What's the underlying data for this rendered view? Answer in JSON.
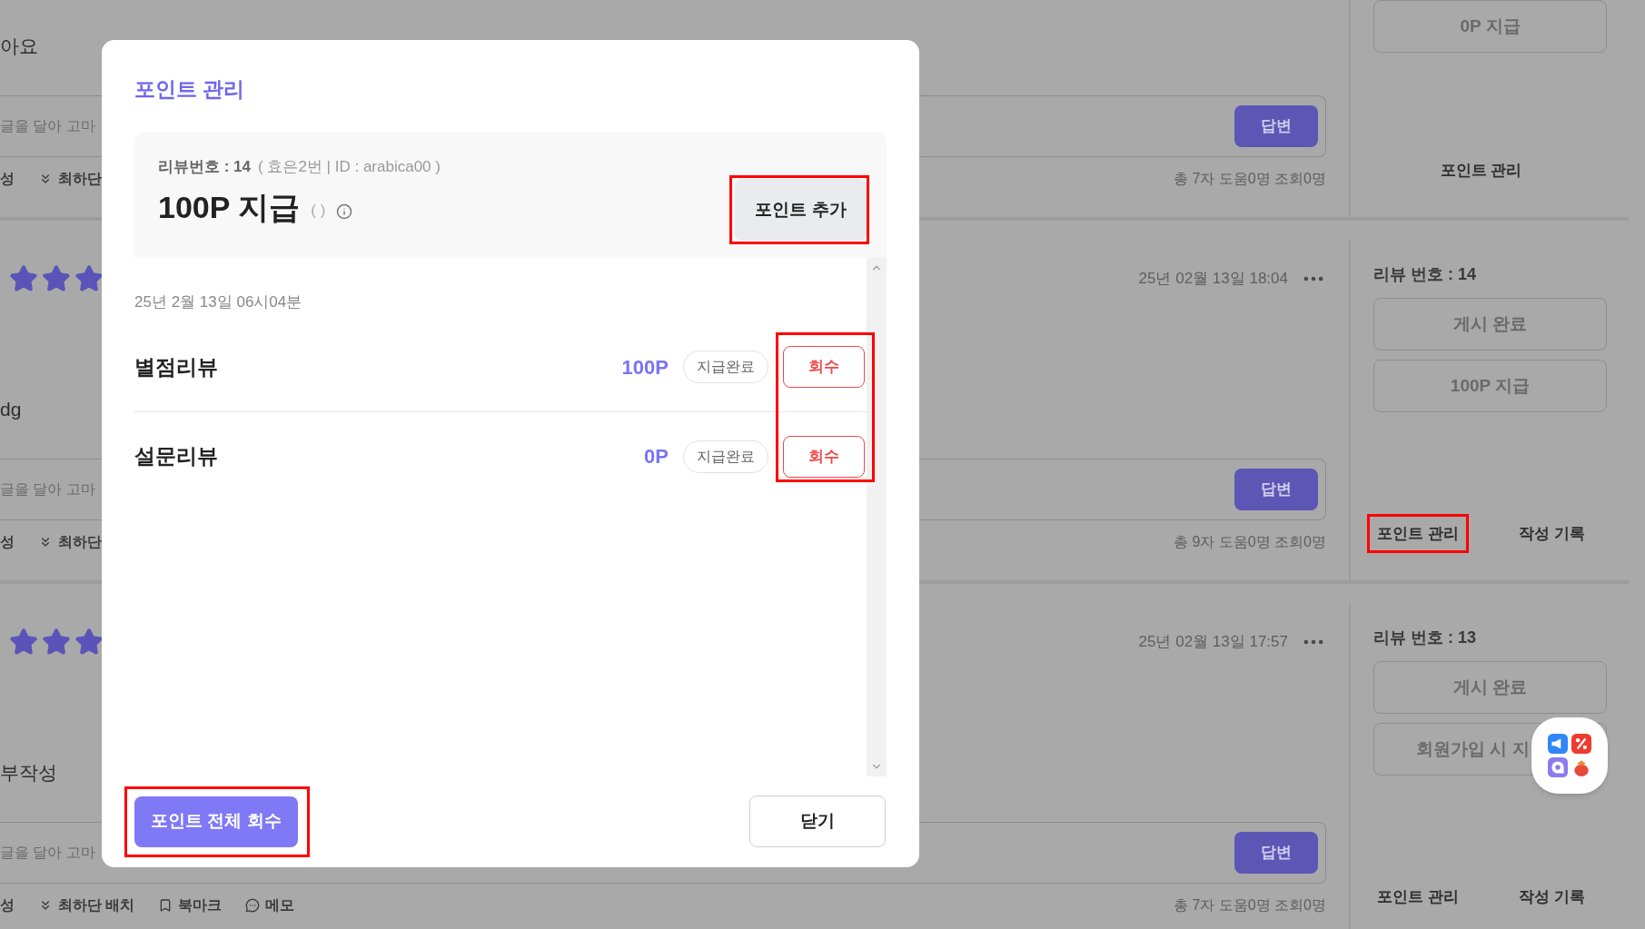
{
  "reviews": [
    {
      "body": "아요",
      "reply_placeholder": "글을 달아 고마",
      "reply_button": "답변",
      "toolbar": [
        {
          "label": "성",
          "kind": "plain"
        },
        {
          "label": "최하단",
          "kind": "bottom"
        }
      ],
      "stats": "총 7자 도움0명 조회0명",
      "side": {
        "buttons": [
          "0P 지급"
        ],
        "links": [
          {
            "label": "포인트 관리",
            "highlighted": false
          }
        ]
      }
    },
    {
      "stars": 3,
      "date": "25년 02월 13일 18:04",
      "body": "dg",
      "reply_placeholder": "글을 달아 고마",
      "reply_button": "답변",
      "toolbar": [
        {
          "label": "성",
          "kind": "plain"
        },
        {
          "label": "최하단",
          "kind": "bottom"
        }
      ],
      "stats": "총 9자 도움0명 조회0명",
      "side": {
        "label": "리뷰 번호 : 14",
        "buttons": [
          "게시 완료",
          "100P 지급"
        ],
        "links": [
          {
            "label": "포인트 관리",
            "highlighted": true
          },
          {
            "label": "작성 기록",
            "highlighted": false
          }
        ]
      }
    },
    {
      "stars": 3,
      "date": "25년 02월 13일 17:57",
      "body": "부작성",
      "reply_placeholder": "글을 달아 고마",
      "reply_button": "답변",
      "toolbar": [
        {
          "label": "성",
          "kind": "plain"
        },
        {
          "label": "최하단 배치",
          "kind": "bottom"
        },
        {
          "label": "북마크",
          "kind": "bookmark"
        },
        {
          "label": "메모",
          "kind": "memo"
        }
      ],
      "stats": "총 7자 도움0명 조회0명",
      "side": {
        "label": "리뷰 번호 : 13",
        "buttons": [
          "게시 완료",
          "회원가입 시 지"
        ],
        "links": [
          {
            "label": "포인트 관리",
            "highlighted": false
          },
          {
            "label": "작성 기록",
            "highlighted": false
          }
        ]
      }
    }
  ],
  "modal": {
    "title": "포인트 관리",
    "review_label": "리뷰번호 : 14",
    "review_meta": "( 효은2번 | ID : arabica00 )",
    "total": "100P 지급",
    "total_note": "( )",
    "add_button": {
      "label": "포인트 추가",
      "highlighted": true
    },
    "date": "25년 2월 13일 06시04분",
    "items": [
      {
        "name": "별점리뷰",
        "points": "100P",
        "status": "지급완료",
        "action": "회수"
      },
      {
        "name": "설문리뷰",
        "points": "0P",
        "status": "지급완료",
        "action": "회수"
      }
    ],
    "revoke_highlighted": true,
    "revoke_all_button": {
      "label": "포인트 전체 회수",
      "highlighted": true
    },
    "close_button": "닫기"
  }
}
